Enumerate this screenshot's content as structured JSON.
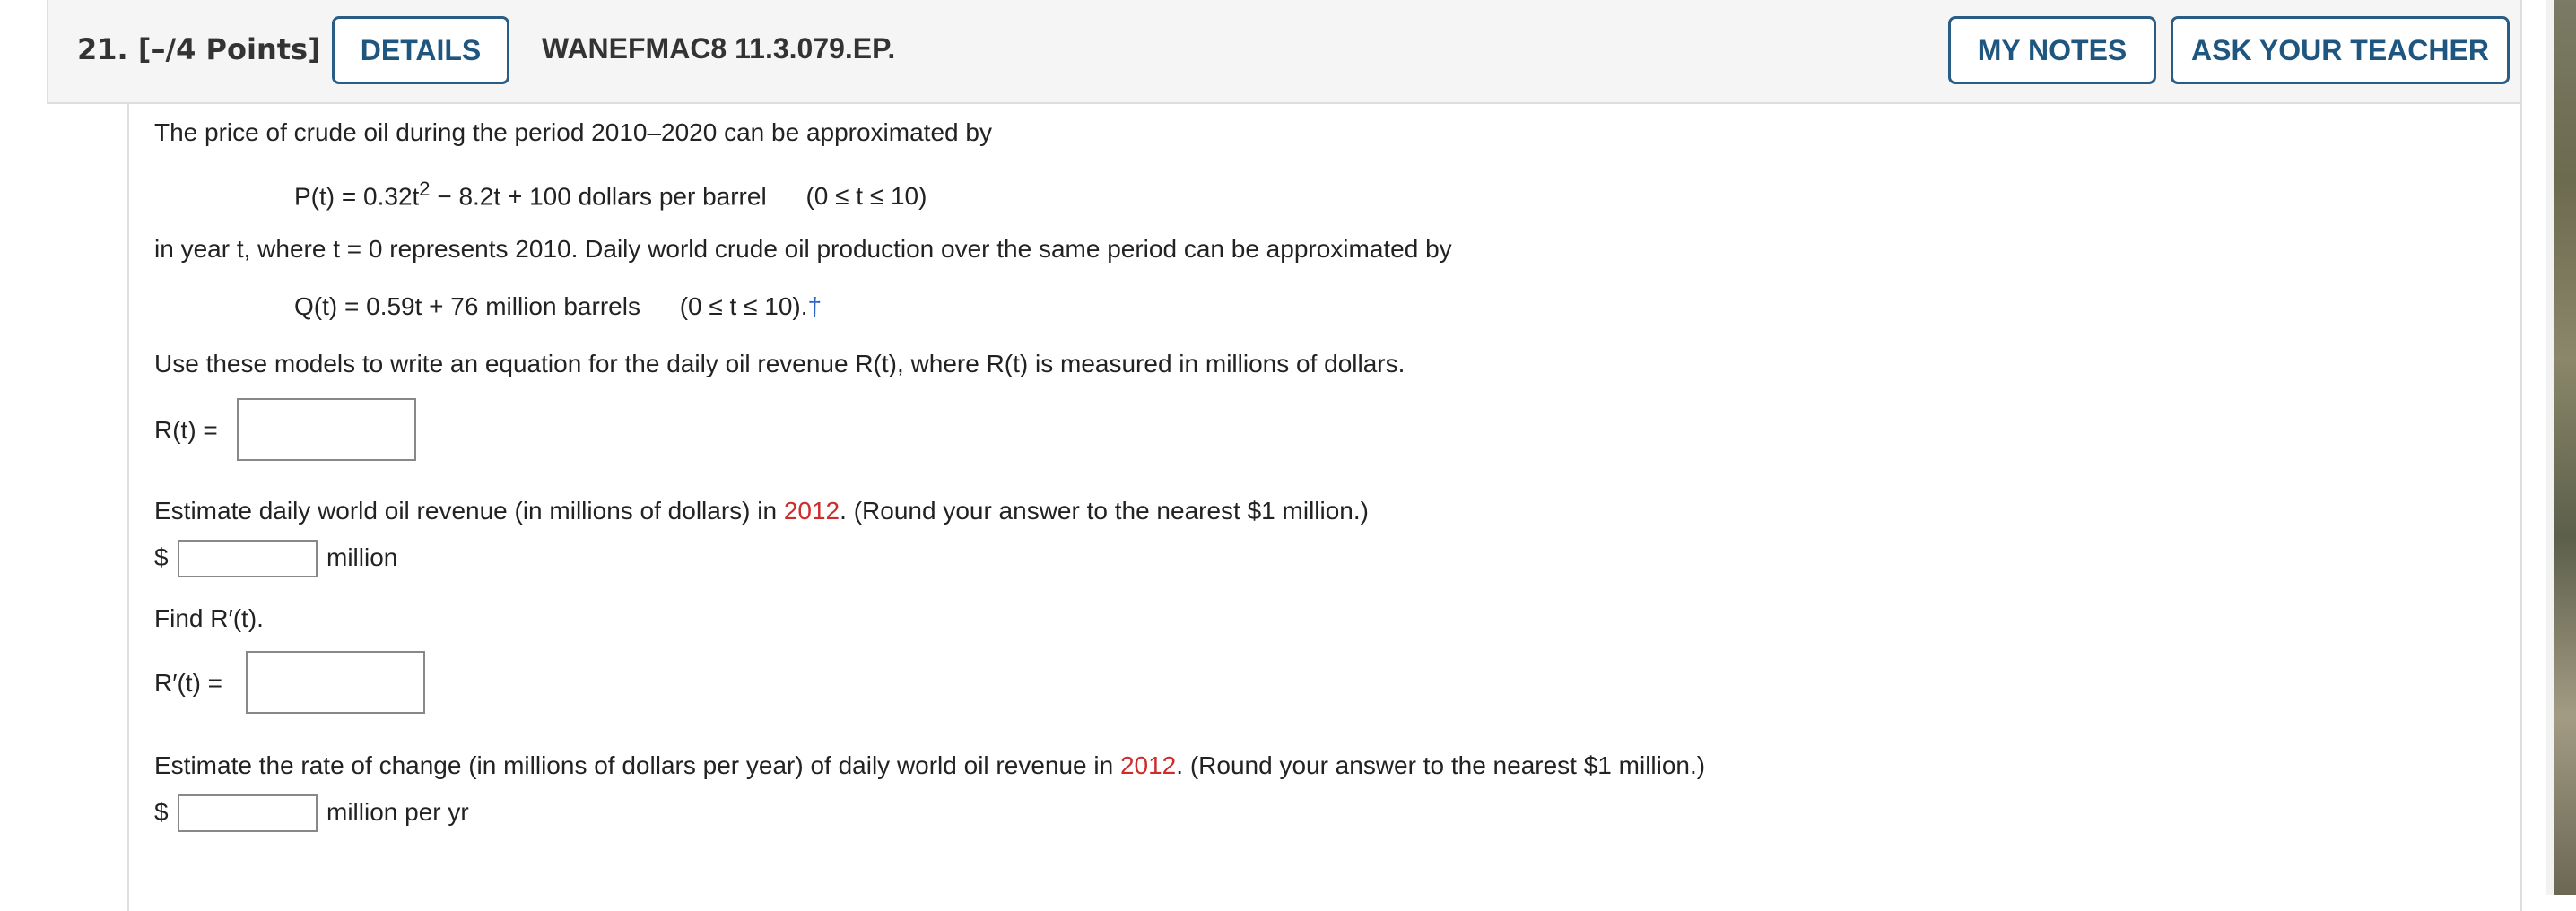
{
  "header": {
    "question_label": "21.  [–/4 Points]",
    "details_button": "DETAILS",
    "assignment_code": "WANEFMAC8 11.3.079.EP.",
    "my_notes_button": "MY NOTES",
    "ask_teacher_button": "ASK YOUR TEACHER"
  },
  "problem": {
    "intro": "The price of crude oil during the period 2010–2020 can be approximated by",
    "eq_p_lhs": "P(t)",
    "eq_p_rhs_a": "= 0.32t",
    "eq_p_exp": "2",
    "eq_p_rhs_b": " − 8.2t + 100 dollars per barrel",
    "eq_p_domain": "(0 ≤ t ≤ 10)",
    "mid": "in year t, where t = 0 represents 2010. Daily world crude oil production over the same period can be approximated by",
    "eq_q": "Q(t) = 0.59t + 76 million barrels",
    "eq_q_domain": "(0 ≤ t ≤ 10).",
    "dagger": "†",
    "instruction": "Use these models to write an equation for the daily oil revenue R(t), where R(t) is measured in millions of dollars.",
    "r_label": "R(t)  =",
    "estimate1_prefix": "Estimate daily world oil revenue (in millions of dollars) in ",
    "year_highlight": "2012",
    "estimate1_suffix": ". (Round your answer to the nearest $1 million.)",
    "dollar": "$",
    "million": "million",
    "find_rprime": "Find R′(t).",
    "rprime_label": "R′(t)  =",
    "estimate2_prefix": "Estimate the rate of change (in millions of dollars per year) of daily world oil revenue in ",
    "estimate2_suffix": ". (Round your answer to the nearest $1 million.)",
    "million_per_yr": "million per yr"
  },
  "inputs": {
    "r_value": "",
    "revenue_2012_value": "",
    "rprime_value": "",
    "rate_2012_value": ""
  },
  "colors": {
    "accent": "#2a5d86",
    "highlight": "#d02b2b",
    "dagger": "#2f62c2"
  }
}
